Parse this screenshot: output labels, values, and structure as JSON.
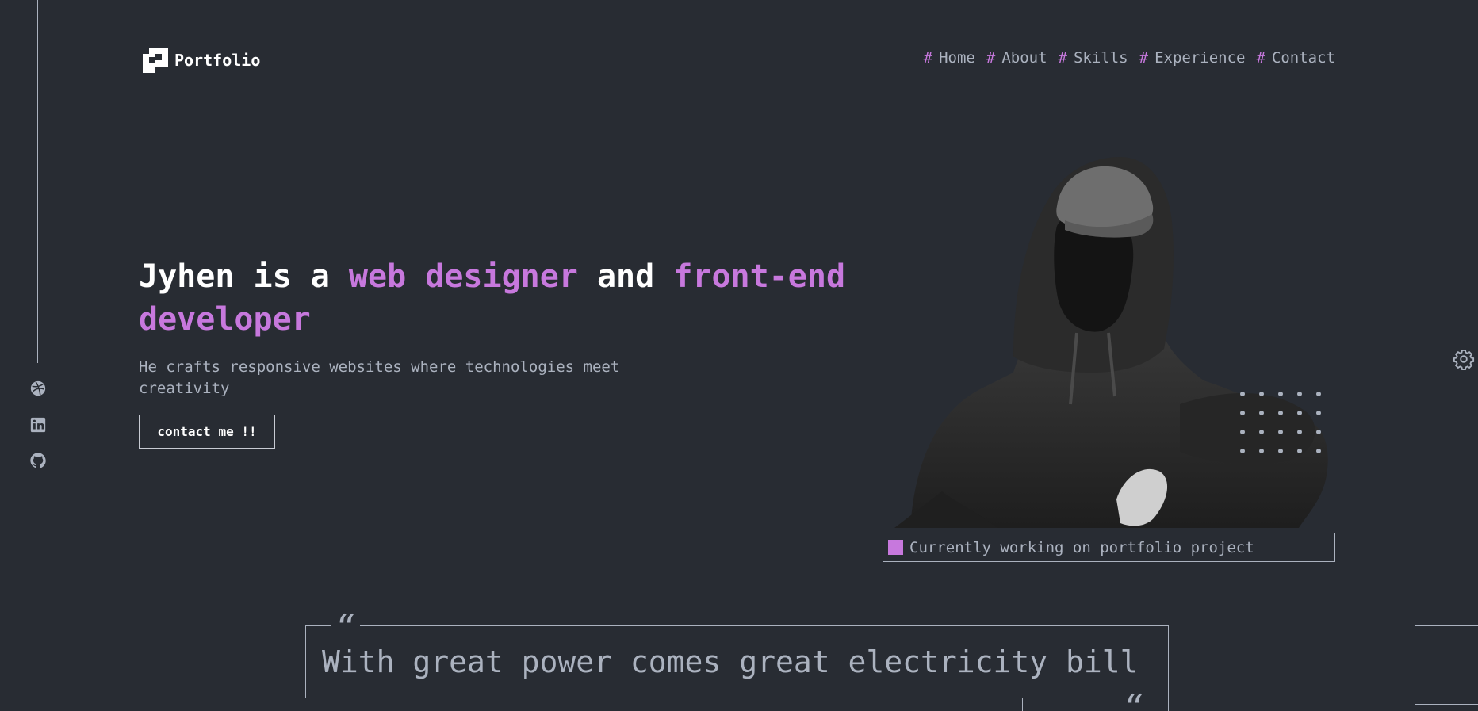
{
  "colors": {
    "background": "#282c33",
    "text": "#abb2bf",
    "accent": "#c778dd",
    "white": "#ffffff"
  },
  "brand": {
    "name": "Portfolio",
    "icon": "logo-icon"
  },
  "nav": {
    "prefix": "#",
    "items": [
      {
        "label": "Home"
      },
      {
        "label": "About"
      },
      {
        "label": "Skills"
      },
      {
        "label": "Experience"
      },
      {
        "label": "Contact"
      }
    ]
  },
  "social": [
    {
      "icon": "dribbble-icon"
    },
    {
      "icon": "linkedin-icon"
    },
    {
      "icon": "github-icon"
    }
  ],
  "hero": {
    "title_part1": "Jyhen is a ",
    "title_accent1": "web designer",
    "title_part2": " and ",
    "title_accent2": "front-end developer",
    "subtitle": "He crafts responsive websites where technologies meet creativity",
    "cta_label": "contact me !!",
    "image_icon": "hooded-person-photo"
  },
  "status": {
    "text": "Currently working on portfolio project"
  },
  "quote": {
    "text": "With great power comes great electricity bill",
    "open_mark": "“",
    "close_mark": "“"
  },
  "settings": {
    "icon": "gear-icon"
  }
}
